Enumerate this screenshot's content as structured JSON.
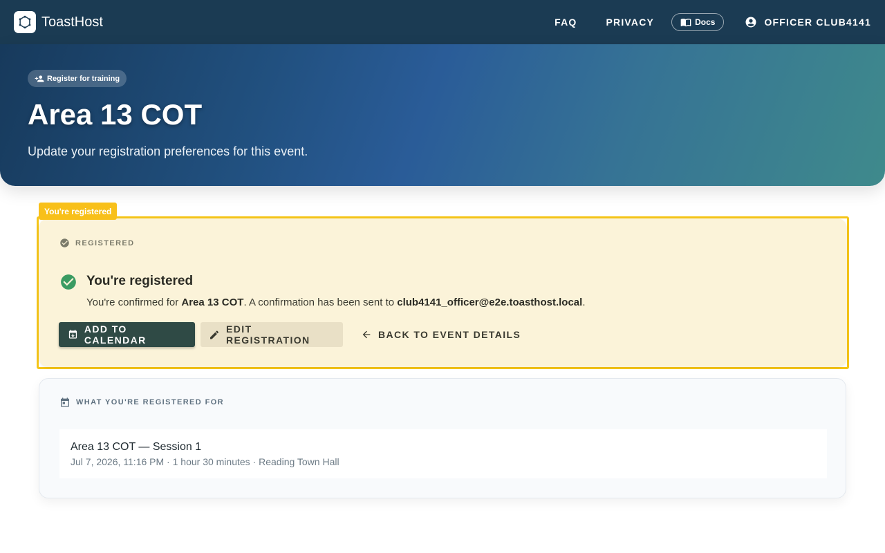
{
  "app": {
    "brand": "ToastHost",
    "nav": {
      "faq": "FAQ",
      "privacy": "PRIVACY",
      "docs": "Docs",
      "account": "OFFICER CLUB4141"
    }
  },
  "hero": {
    "chip": "Register for training",
    "title": "Area 13 COT",
    "subtitle": "Update your registration preferences for this event."
  },
  "registration": {
    "tag": "You're registered",
    "section_label": "REGISTERED",
    "status_title": "You're registered",
    "message_prefix": "You're confirmed for ",
    "event_name": "Area 13 COT",
    "message_middle": ". A confirmation has been sent to ",
    "email": "club4141_officer@e2e.toasthost.local",
    "message_suffix": ".",
    "actions": {
      "add_to_calendar": "ADD TO CALENDAR",
      "edit_registration": "EDIT REGISTRATION",
      "back_to_event": "BACK TO EVENT DETAILS"
    }
  },
  "details": {
    "section_label": "WHAT YOU'RE REGISTERED FOR",
    "sessions": [
      {
        "title": "Area 13 COT — Session 1",
        "meta": "Jul 7, 2026, 11:16 PM · 1 hour 30 minutes · Reading Town Hall"
      }
    ]
  },
  "colors": {
    "appbar": "#1b3b53",
    "highlight": "#f5c518",
    "success": "#3a9b62",
    "primary_button": "#2f4a45"
  },
  "icons": [
    "logo-icon",
    "book-icon",
    "account-circle-icon",
    "person-add-icon",
    "check-circle-icon",
    "calendar-download-icon",
    "pencil-icon",
    "arrow-left-icon",
    "calendar-icon"
  ]
}
